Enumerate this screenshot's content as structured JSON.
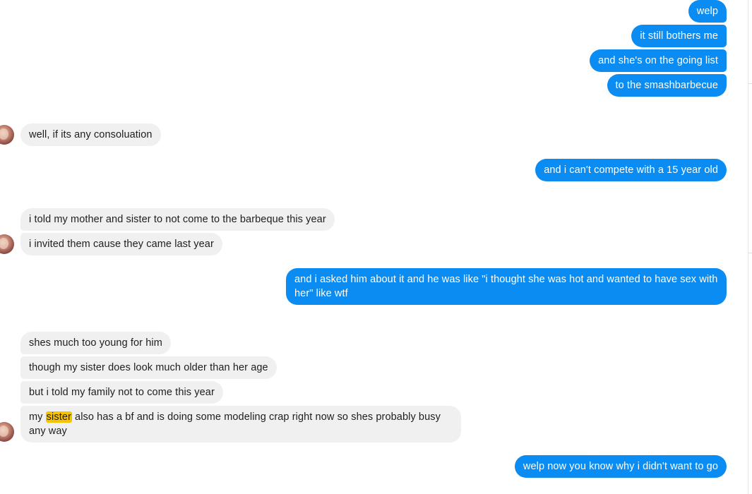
{
  "messages": {
    "m1": "welp",
    "m2": "it still bothers me",
    "m3": "and she's on the going list",
    "m4": "to the smashbarbecue",
    "m5": "well, if its any consoluation",
    "m6": "and i can't compete with a 15 year old",
    "m7": "i told my mother and sister to not come to the barbeque this year",
    "m8": "i invited them cause they came last year",
    "m9": "and i asked him about it and he was like \"i thought she was hot and wanted to have sex with her\" like wtf",
    "m10": "shes much too young for him",
    "m11": "though my sister does look much older than her age",
    "m12": "but i told my family not to come this year",
    "m13": {
      "before": "my ",
      "highlight": "sister",
      "after": " also has a bf and is doing some modeling crap right now so shes probably busy any way"
    },
    "m14": "welp now you know why i didn't want to go"
  },
  "colors": {
    "outgoing_bubble": "#0a8cf2",
    "incoming_bubble": "#f0f0f0",
    "highlight": "#f7c200"
  }
}
